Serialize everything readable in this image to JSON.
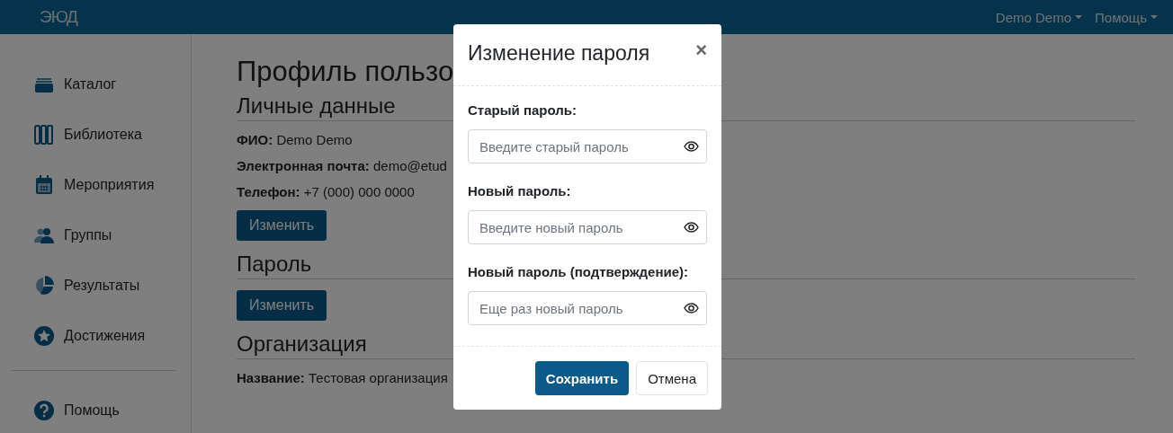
{
  "navbar": {
    "logo": "ЭЮД",
    "menus": [
      {
        "label": "Demo Demo"
      },
      {
        "label": "Помощь"
      }
    ]
  },
  "sidebar": {
    "items": [
      {
        "label": "Каталог"
      },
      {
        "label": "Библиотека"
      },
      {
        "label": "Мероприятия"
      },
      {
        "label": "Группы"
      },
      {
        "label": "Результаты"
      },
      {
        "label": "Достижения"
      }
    ],
    "footer_items": [
      {
        "label": "Помощь"
      }
    ]
  },
  "content": {
    "title": "Профиль пользо",
    "sections": [
      {
        "heading": "Личные данные",
        "lines": [
          "**ФИО:** Demo Demo",
          "**Электронная почта:** demo@etud",
          "**Телефон:** +7 (000) 000 0000"
        ],
        "button": "Изменить"
      },
      {
        "heading": "Пароль",
        "button": "Изменить"
      },
      {
        "heading": "Организация",
        "lines": [
          "**Название:** Тестовая организация"
        ]
      }
    ]
  },
  "modal": {
    "title": "Изменение пароля",
    "close": "×",
    "fields": [
      {
        "label": "Старый пароль:",
        "placeholder": "Введите старый пароль"
      },
      {
        "label": "Новый пароль:",
        "placeholder": "Введите новый пароль"
      },
      {
        "label": "Новый пароль (подтверждение):",
        "placeholder": "Еще раз новый пароль"
      }
    ],
    "buttons": [
      {
        "label": "Сохранить",
        "kind": "primary"
      },
      {
        "label": "Отмена",
        "kind": "secondary"
      }
    ]
  }
}
